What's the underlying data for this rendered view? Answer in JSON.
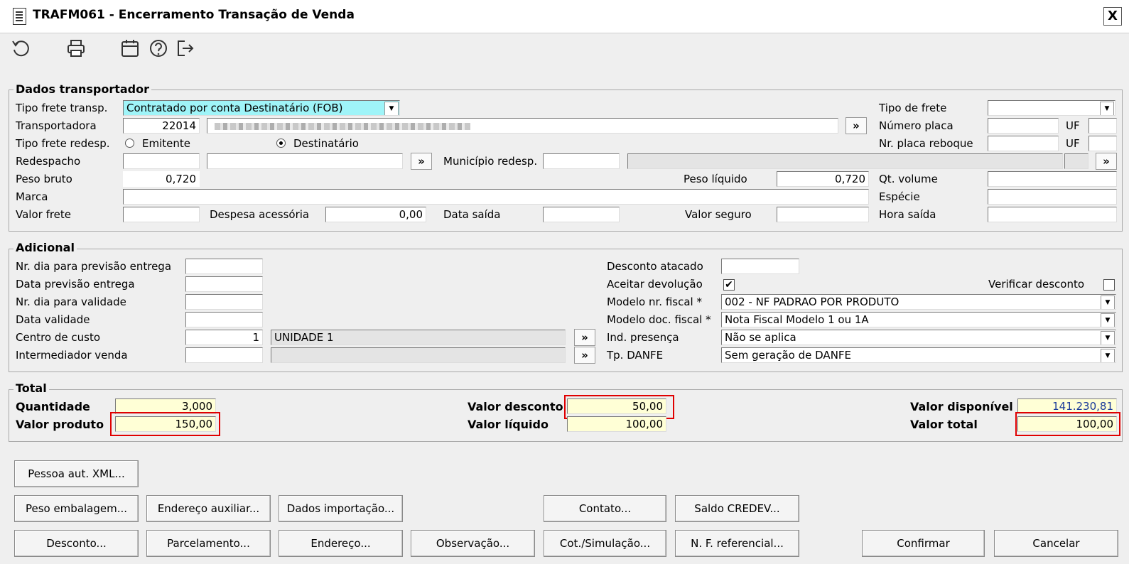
{
  "window": {
    "title": "TRAFM061 - Encerramento Transação de Venda",
    "close_label": "X"
  },
  "toolbar": {
    "icons": [
      "refresh-icon",
      "print-icon",
      "calendar-icon",
      "help-icon",
      "exit-icon"
    ]
  },
  "transportador": {
    "title": "Dados transportador",
    "tipo_frete_transp_label": "Tipo frete transp.",
    "tipo_frete_transp_value": "Contratado por conta Destinatário (FOB)",
    "transportadora_label": "Transportadora",
    "transportadora_code": "22014",
    "tipo_frete_redesp_label": "Tipo frete redesp.",
    "radio_emitente": "Emitente",
    "radio_destinatario": "Destinatário",
    "redespacho_label": "Redespacho",
    "municipio_redesp_label": "Município redesp.",
    "peso_bruto_label": "Peso bruto",
    "peso_bruto_value": "0,720",
    "peso_liquido_label": "Peso líquido",
    "peso_liquido_value": "0,720",
    "marca_label": "Marca",
    "valor_frete_label": "Valor frete",
    "despesa_label": "Despesa acessória",
    "despesa_value": "0,00",
    "data_saida_label": "Data saída",
    "valor_seguro_label": "Valor seguro",
    "tipo_de_frete_label": "Tipo de frete",
    "numero_placa_label": "Número placa",
    "uf_label": "UF",
    "nr_placa_reboque_label": "Nr. placa reboque",
    "qt_volume_label": "Qt. volume",
    "especie_label": "Espécie",
    "hora_saida_label": "Hora saída",
    "lookup_symbol": "»"
  },
  "adicional": {
    "title": "Adicional",
    "nr_dia_prev_label": "Nr. dia para previsão entrega",
    "data_prev_label": "Data previsão entrega",
    "nr_dia_valid_label": "Nr. dia para validade",
    "data_valid_label": "Data validade",
    "centro_custo_label": "Centro de custo",
    "centro_custo_code": "1",
    "centro_custo_desc": "UNIDADE 1",
    "intermediador_label": "Intermediador venda",
    "desconto_atacado_label": "Desconto atacado",
    "aceitar_devolucao_label": "Aceitar devolução",
    "verificar_desconto_label": "Verificar desconto",
    "modelo_nr_fiscal_label": "Modelo nr. fiscal *",
    "modelo_nr_fiscal_value": "002 - NF PADRAO POR PRODUTO",
    "modelo_doc_fiscal_label": "Modelo doc. fiscal *",
    "modelo_doc_fiscal_value": "Nota Fiscal Modelo 1 ou 1A",
    "ind_presenca_label": "Ind. presença",
    "ind_presenca_value": "Não se aplica",
    "tp_danfe_label": "Tp. DANFE",
    "tp_danfe_value": "Sem geração de DANFE",
    "check_mark": "✔"
  },
  "total": {
    "title": "Total",
    "quantidade_label": "Quantidade",
    "quantidade_value": "3,000",
    "valor_produto_label": "Valor produto",
    "valor_produto_value": "150,00",
    "valor_desconto_label": "Valor desconto",
    "valor_desconto_value": "50,00",
    "valor_liquido_label": "Valor líquido",
    "valor_liquido_value": "100,00",
    "valor_disponivel_label": "Valor disponível",
    "valor_disponivel_value": "141.230,81",
    "valor_total_label": "Valor total",
    "valor_total_value": "100,00"
  },
  "buttons": {
    "pessoa_aut_xml": "Pessoa aut. XML...",
    "peso_embalagem": "Peso embalagem...",
    "endereco_auxiliar": "Endereço auxiliar...",
    "dados_importacao": "Dados importação...",
    "contato": "Contato...",
    "saldo_credev": "Saldo CREDEV...",
    "desconto": "Desconto...",
    "parcelamento": "Parcelamento...",
    "endereco": "Endereço...",
    "observacao": "Observação...",
    "cot_simulacao": "Cot./Simulação...",
    "nf_referencial": "N. F. referencial...",
    "confirmar": "Confirmar",
    "cancelar": "Cancelar"
  },
  "colors": {
    "highlight_red": "#e00000",
    "cyan_field": "#9ff4f8",
    "yellow_field": "#ffffd6",
    "blue_value": "#1a3a9a"
  }
}
